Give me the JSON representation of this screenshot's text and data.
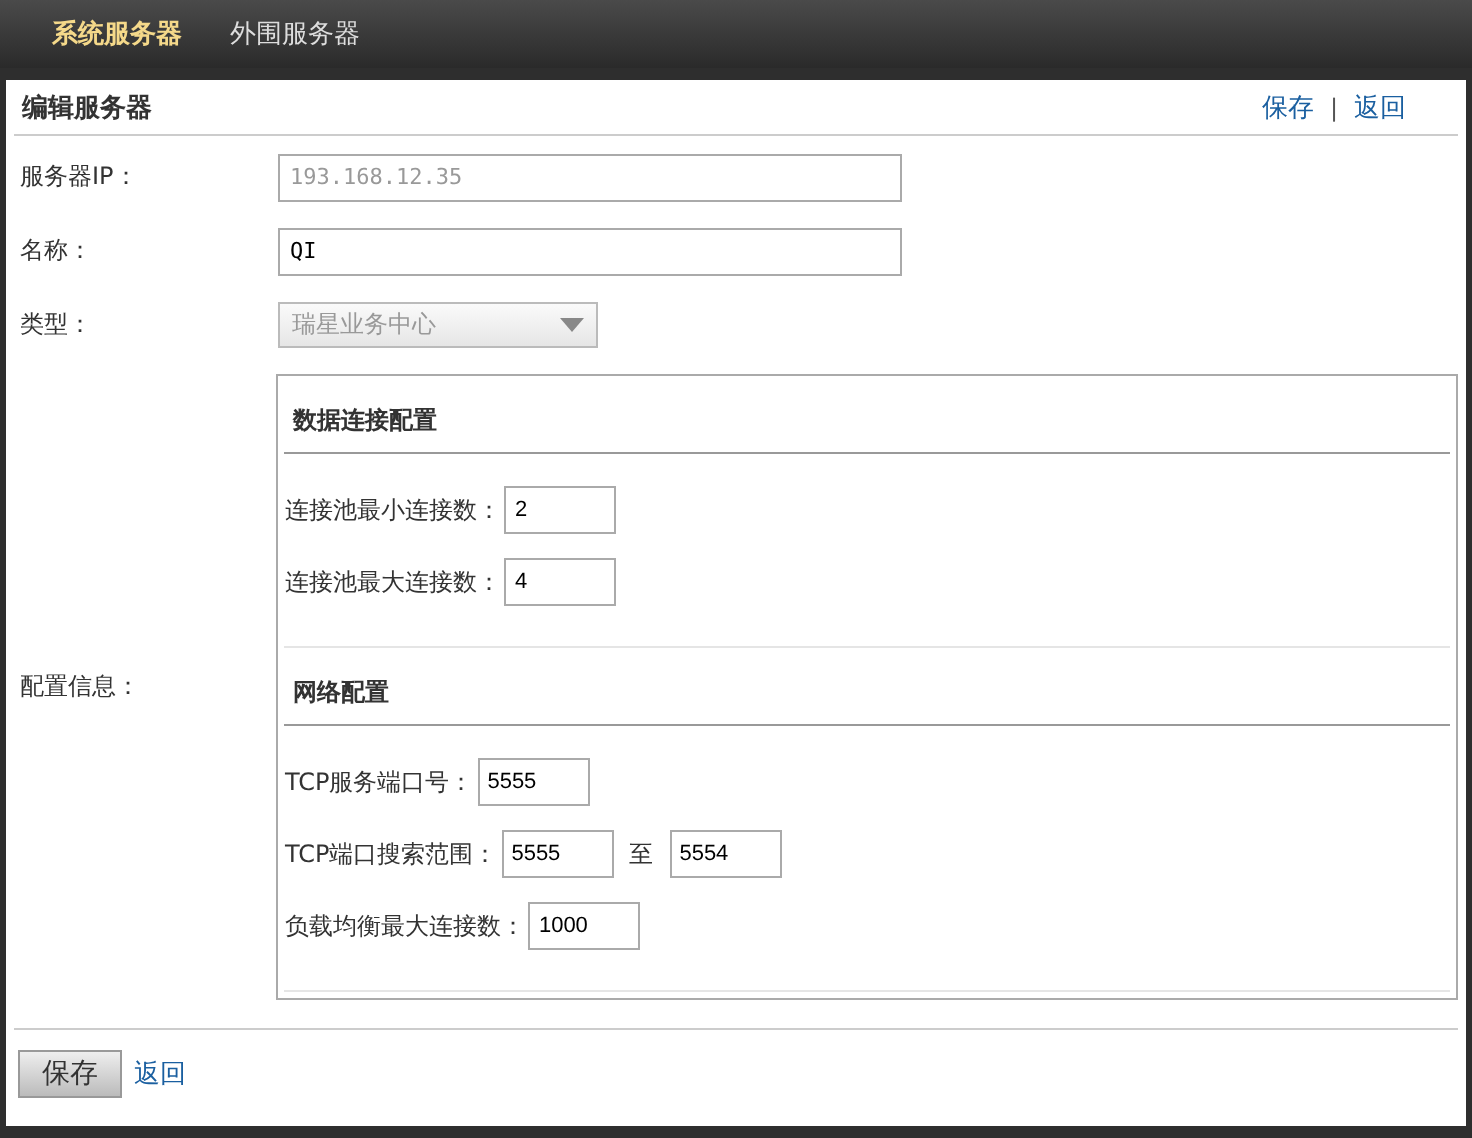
{
  "tabs": [
    {
      "label": "系统服务器",
      "selected": true
    },
    {
      "label": "外围服务器",
      "selected": false
    }
  ],
  "panel": {
    "title": "编辑服务器",
    "actions": [
      {
        "label": "保存"
      },
      {
        "label": "返回"
      }
    ],
    "separator": "|"
  },
  "form": [
    {
      "kind": "text",
      "label": "服务器IP：",
      "value": "193.168.12.35",
      "disabled": true
    },
    {
      "kind": "text",
      "label": "名称：",
      "value": "QI",
      "disabled": false
    },
    {
      "kind": "select",
      "label": "类型：",
      "value": "瑞星业务中心",
      "disabled": true
    }
  ],
  "config": {
    "label": "配置信息：",
    "sections": [
      {
        "title": "数据连接配置",
        "fields": [
          {
            "kind": "single",
            "label": "连接池最小连接数：",
            "value": "2"
          },
          {
            "kind": "single",
            "label": "连接池最大连接数：",
            "value": "4"
          }
        ]
      },
      {
        "title": "网络配置",
        "fields": [
          {
            "kind": "single",
            "label": "TCP服务端口号：",
            "value": "5555"
          },
          {
            "kind": "range",
            "label": "TCP端口搜索范围：",
            "value": "5555",
            "joiner": "至",
            "value_to": "5554"
          },
          {
            "kind": "single",
            "label": "负载均衡最大连接数：",
            "value": "1000"
          }
        ]
      }
    ]
  },
  "footer": {
    "save": "保存",
    "back": "返回"
  }
}
